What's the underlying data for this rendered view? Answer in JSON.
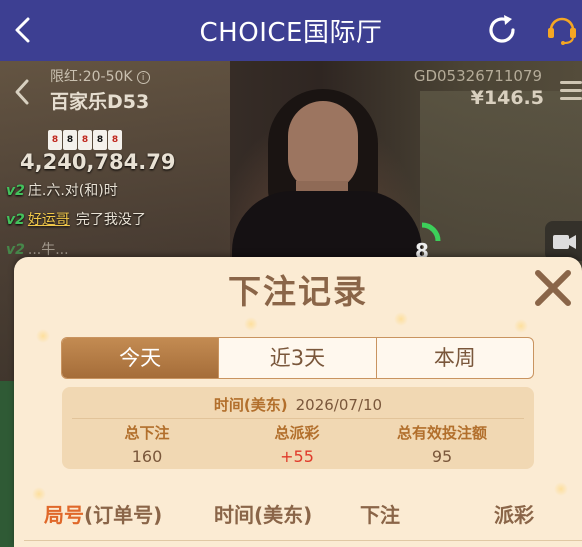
{
  "topbar": {
    "title": "CHOICE国际厅",
    "back_icon": "chevron-left-icon",
    "refresh_icon": "refresh-icon",
    "support_icon": "customer-service-headset-icon",
    "background": "#3d3f92"
  },
  "live_table": {
    "limit_label": "限红:20-50K",
    "table_name": "百家乐D53",
    "game_id": "GD05326711079",
    "balance": "¥146.5",
    "pool_amount": "4,240,784.79",
    "chat": [
      {
        "vip": "v2",
        "user": "",
        "text": "庄.六.对(和)时"
      },
      {
        "vip": "v2",
        "user": "好运哥",
        "text": "完了我没了"
      },
      {
        "vip": "v2",
        "user": "",
        "text": "...牛..."
      }
    ],
    "timer": "8",
    "cards": [
      "8",
      "8",
      "8",
      "8",
      "8"
    ]
  },
  "modal": {
    "title": "下注记录",
    "close_icon": "close-x-icon",
    "tabs": [
      {
        "label": "今天",
        "active": true
      },
      {
        "label": "近3天",
        "active": false
      },
      {
        "label": "本周",
        "active": false
      }
    ],
    "summary": {
      "date_label": "时间(美东)",
      "date_value": "2026/07/10",
      "total_bet_label": "总下注",
      "total_bet_value": "160",
      "total_payout_label": "总派彩",
      "total_payout_value": "+55",
      "valid_bet_label": "总有效投注额",
      "valid_bet_value": "95"
    },
    "columns": {
      "round_main": "局号",
      "round_sub": "(订单号)",
      "time": "时间(美东)",
      "bet": "下注",
      "payout": "派彩"
    },
    "accent": "#a56d39",
    "highlight_red": "#e03a2a"
  }
}
